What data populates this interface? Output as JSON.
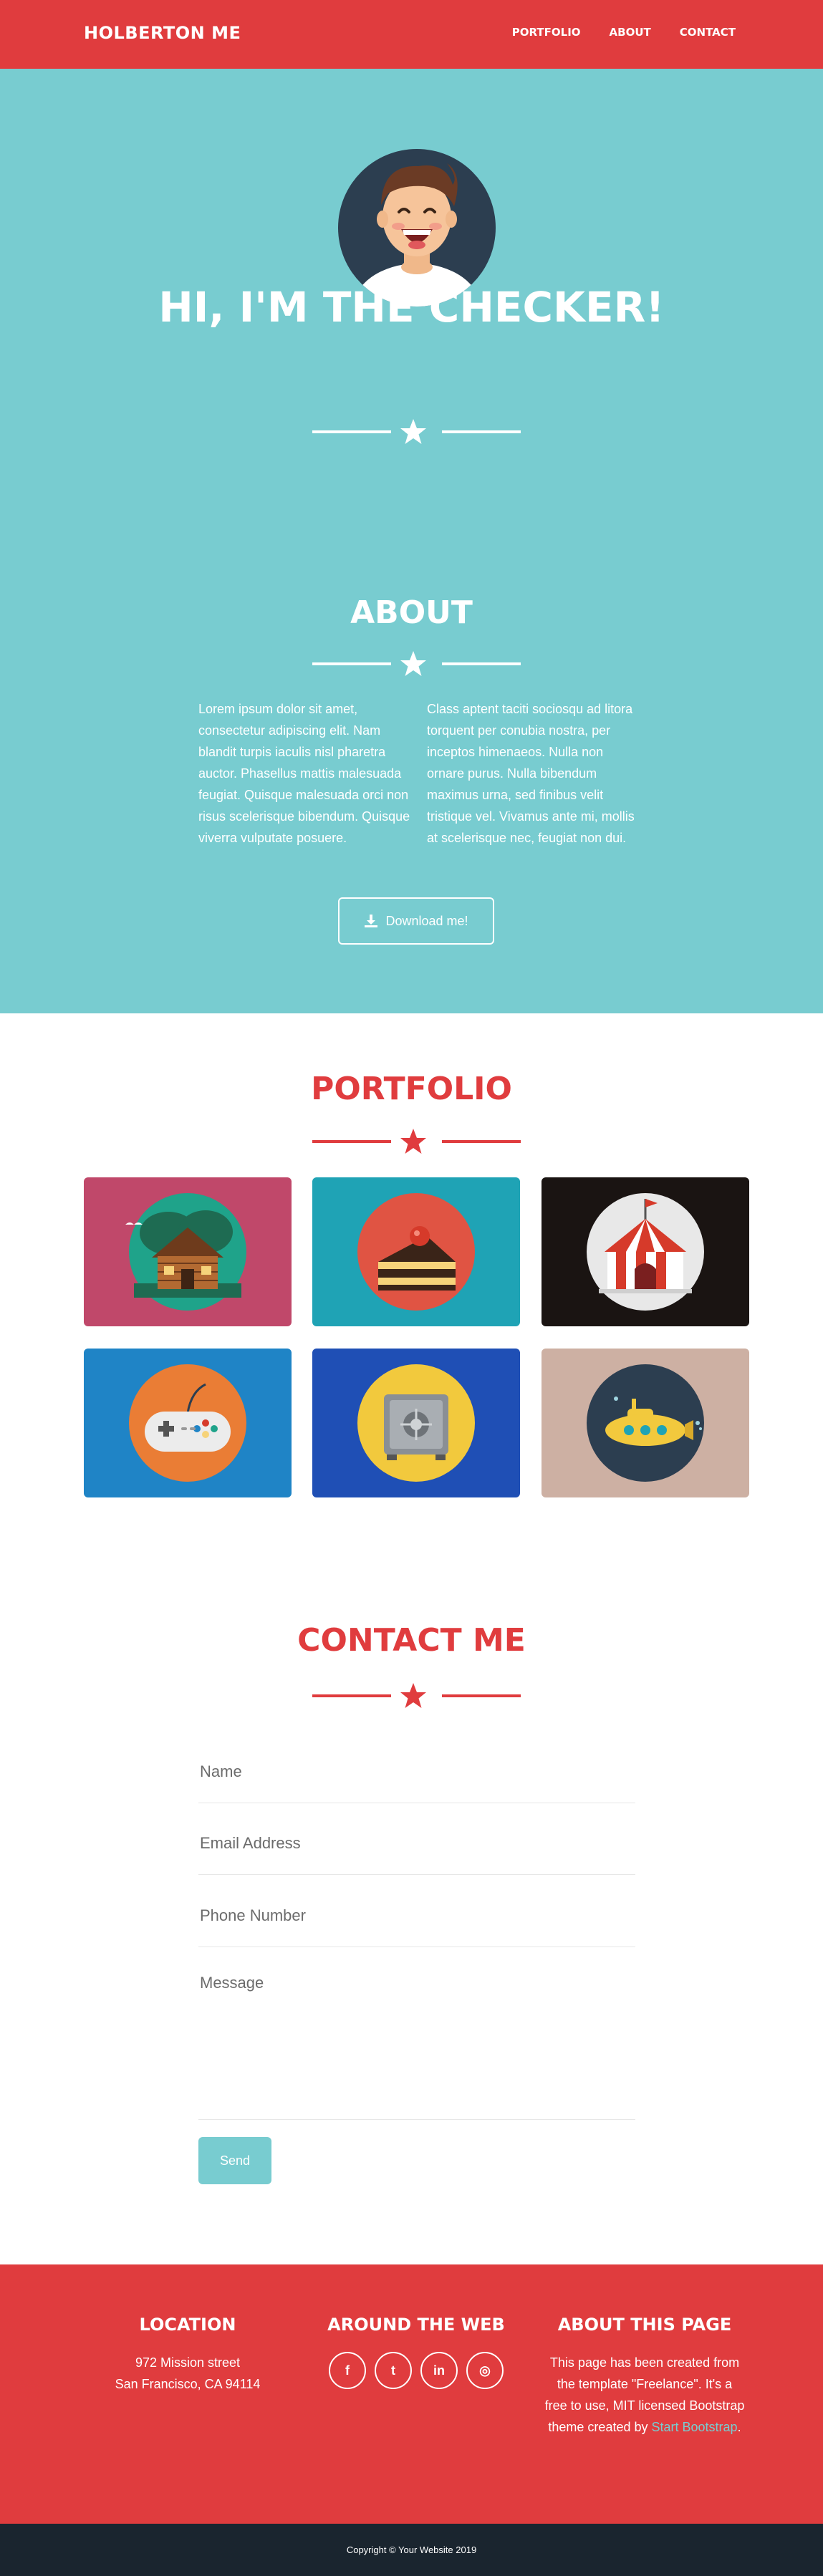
{
  "navbar": {
    "brand": "HOLBERTON ME",
    "links": [
      "PORTFOLIO",
      "ABOUT",
      "CONTACT"
    ],
    "color": "#e03c3e"
  },
  "hero": {
    "title": "HI, I'M THE CHECKER!",
    "color": "#78ccd0"
  },
  "about": {
    "title": "ABOUT",
    "col1": "Lorem ipsum dolor sit amet, consectetur adipiscing elit. Nam blandit turpis iaculis nisl pharetra auctor. Phasellus mattis malesuada feugiat. Quisque malesuada orci non risus scelerisque bibendum. Quisque viverra vulputate posuere.",
    "col2": "Class aptent taciti sociosqu ad litora torquent per conubia nostra, per inceptos himenaeos. Nulla non ornare purus. Nulla bibendum maximus urna, sed finibus velit tristique vel. Vivamus ante mi, mollis at scelerisque nec, feugiat non dui.",
    "download_label": "Download me!"
  },
  "portfolio": {
    "title": "PORTFOLIO",
    "items": [
      {
        "icon": "cabin-icon",
        "bg": "#c0486a"
      },
      {
        "icon": "cake-icon",
        "bg": "#1fa3b5"
      },
      {
        "icon": "circus-tent-icon",
        "bg": "#1a1412"
      },
      {
        "icon": "game-controller-icon",
        "bg": "#1f84c6"
      },
      {
        "icon": "safe-icon",
        "bg": "#1f4fb5"
      },
      {
        "icon": "submarine-icon",
        "bg": "#cdb0a3"
      }
    ]
  },
  "contact": {
    "title": "CONTACT ME",
    "name_placeholder": "Name",
    "email_placeholder": "Email Address",
    "phone_placeholder": "Phone Number",
    "message_placeholder": "Message",
    "send_label": "Send"
  },
  "footer": {
    "location_title": "LOCATION",
    "address_line1": "972 Mission street",
    "address_line2": "San Francisco, CA 94114",
    "web_title": "AROUND THE WEB",
    "socials": [
      {
        "icon": "facebook-icon",
        "glyph": "f"
      },
      {
        "icon": "twitter-icon",
        "glyph": "t"
      },
      {
        "icon": "linkedin-icon",
        "glyph": "in"
      },
      {
        "icon": "dribbble-icon",
        "glyph": "◎"
      }
    ],
    "about_title": "ABOUT THIS PAGE",
    "about_text": "This page has been created from the template \"Freelance\". It's a free to use, MIT licensed Bootstrap theme created by",
    "about_link": "Start Bootstrap",
    "about_end": ".",
    "copyright": "Copyright © Your Website 2019"
  }
}
